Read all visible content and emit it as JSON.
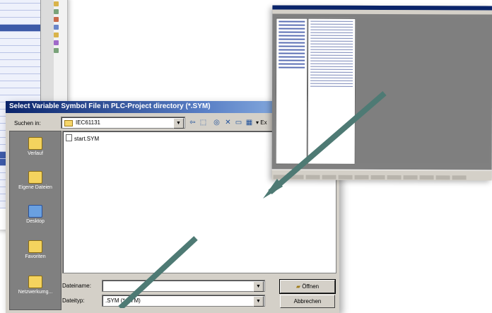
{
  "dialog": {
    "title": "Select Variable Symbol File in PLC-Project directory (*.SYM)",
    "look_in_label": "Suchen in:",
    "look_in_value": "IEC61131",
    "toolbar_icons": [
      "back-icon",
      "up-folder-icon",
      "search-web-icon",
      "delete-icon",
      "new-folder-icon",
      "views-icon"
    ],
    "toolbar_extra": "▾ Ex",
    "places": [
      "Verlauf",
      "Eigene Dateien",
      "Desktop",
      "Favoriten",
      "Netzwerkumg..."
    ],
    "files": [
      "start.SYM"
    ],
    "filename_label": "Dateiname:",
    "filename_value": "",
    "filetype_label": "Dateityp:",
    "filetype_value": ".SYM (*.SYM)",
    "open_button": "Öffnen",
    "cancel_button": "Abbrechen"
  },
  "arrow_color": "#4e7a74"
}
